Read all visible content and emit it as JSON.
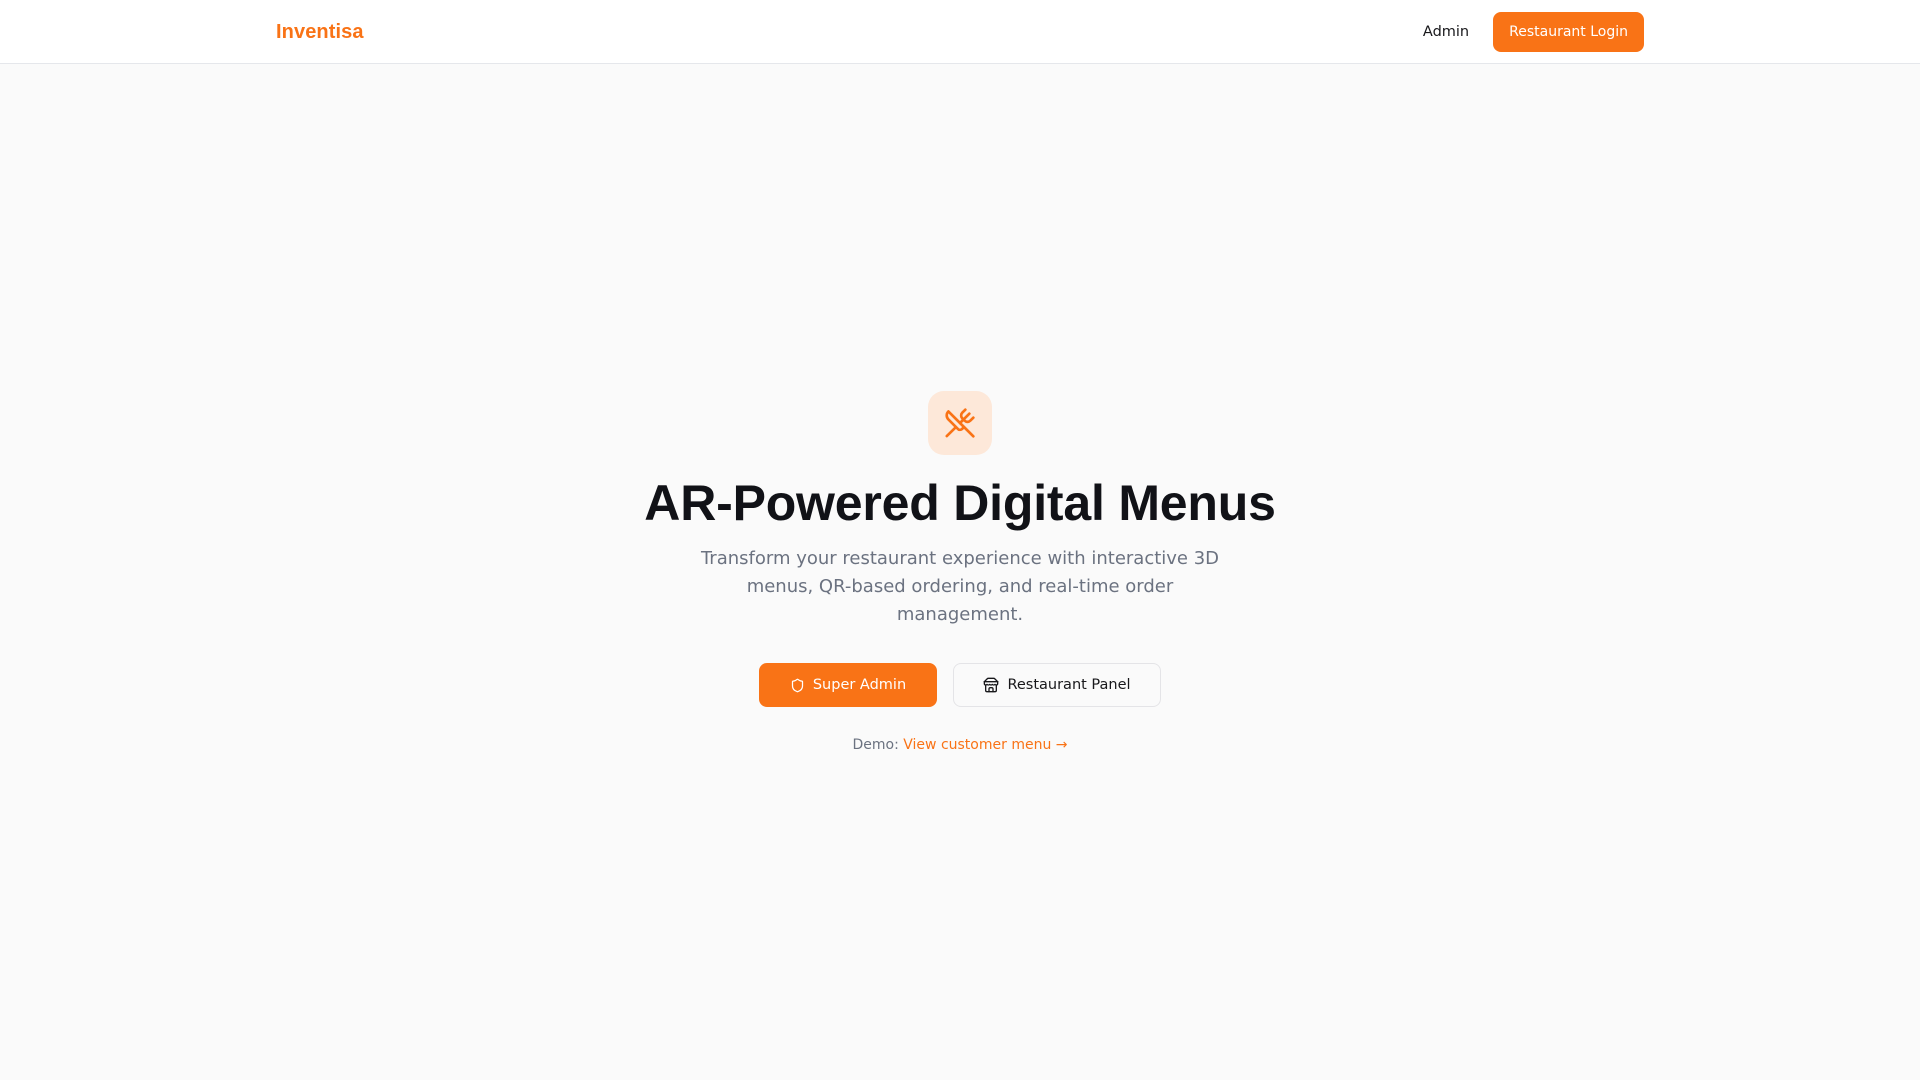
{
  "header": {
    "brand": "Inventisa",
    "nav_admin": "Admin",
    "login_button": "Restaurant Login"
  },
  "hero": {
    "logo_icon": "utensils-crossed-icon",
    "title": "AR-Powered Digital Menus",
    "subtitle": "Transform your restaurant experience with interactive 3D menus, QR-based ordering, and real-time order management.",
    "primary_button": {
      "label": "Super Admin",
      "icon": "shield-icon"
    },
    "secondary_button": {
      "label": "Restaurant Panel",
      "icon": "store-icon"
    },
    "demo_prefix": "Demo:",
    "demo_link": "View customer menu →"
  },
  "colors": {
    "accent": "#f97316",
    "accent_soft": "#fde8d9",
    "background": "#fafafa",
    "text_primary": "#111217",
    "text_muted": "#6b7280"
  }
}
